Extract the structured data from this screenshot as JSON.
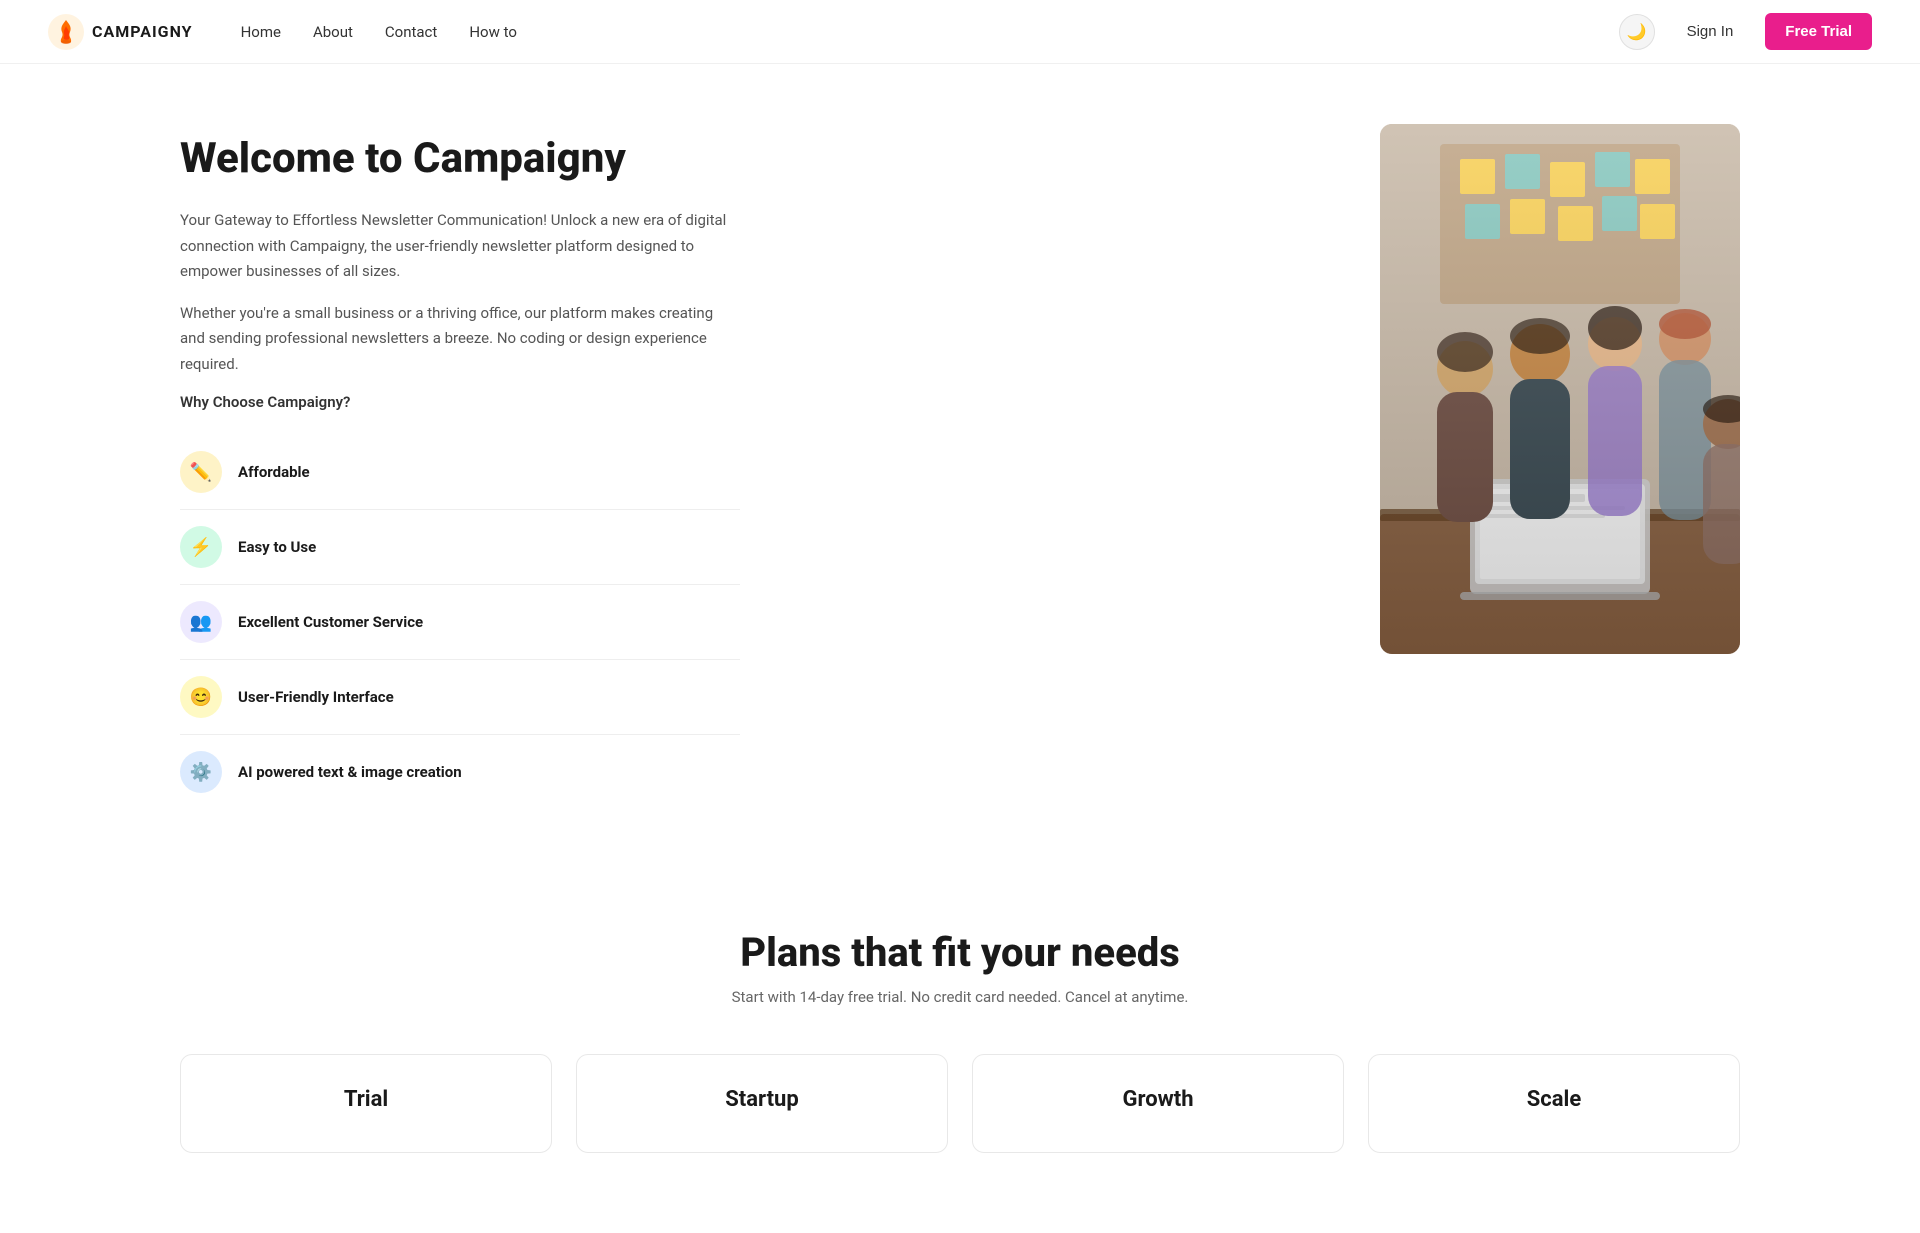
{
  "navbar": {
    "logo_text": "CAMPAIGNY",
    "nav_items": [
      {
        "label": "Home",
        "id": "home"
      },
      {
        "label": "About",
        "id": "about"
      },
      {
        "label": "Contact",
        "id": "contact"
      },
      {
        "label": "How to",
        "id": "howto"
      }
    ],
    "sign_in_label": "Sign In",
    "free_trial_label": "Free Trial",
    "theme_icon": "🌙"
  },
  "hero": {
    "title": "Welcome to Campaigny",
    "desc1": "Your Gateway to Effortless Newsletter Communication! Unlock a new era of digital connection with Campaigny, the user-friendly newsletter platform designed to empower businesses of all sizes.",
    "desc2": "Whether you're a small business or a thriving office, our platform makes creating and sending professional newsletters a breeze. No coding or design experience required.",
    "why_label": "Why Choose Campaigny?",
    "features": [
      {
        "id": "affordable",
        "label": "Affordable",
        "icon": "✏️",
        "icon_bg": "#fef3c7",
        "icon_color": "#d97706"
      },
      {
        "id": "easy-to-use",
        "label": "Easy to Use",
        "icon": "⚡",
        "icon_bg": "#d1fae5",
        "icon_color": "#059669"
      },
      {
        "id": "customer-service",
        "label": "Excellent Customer Service",
        "icon": "👥",
        "icon_bg": "#ede9fe",
        "icon_color": "#7c3aed"
      },
      {
        "id": "user-friendly",
        "label": "User-Friendly Interface",
        "icon": "😊",
        "icon_bg": "#fef9c3",
        "icon_color": "#ca8a04"
      },
      {
        "id": "ai-powered",
        "label": "AI powered text & image creation",
        "icon": "⚙️",
        "icon_bg": "#dbeafe",
        "icon_color": "#3b82f6"
      }
    ]
  },
  "plans": {
    "title": "Plans that fit your needs",
    "subtitle": "Start with 14-day free trial. No credit card needed. Cancel at anytime.",
    "cards": [
      {
        "id": "trial",
        "name": "Trial"
      },
      {
        "id": "startup",
        "name": "Startup"
      },
      {
        "id": "growth",
        "name": "Growth"
      },
      {
        "id": "scale",
        "name": "Scale"
      }
    ]
  }
}
